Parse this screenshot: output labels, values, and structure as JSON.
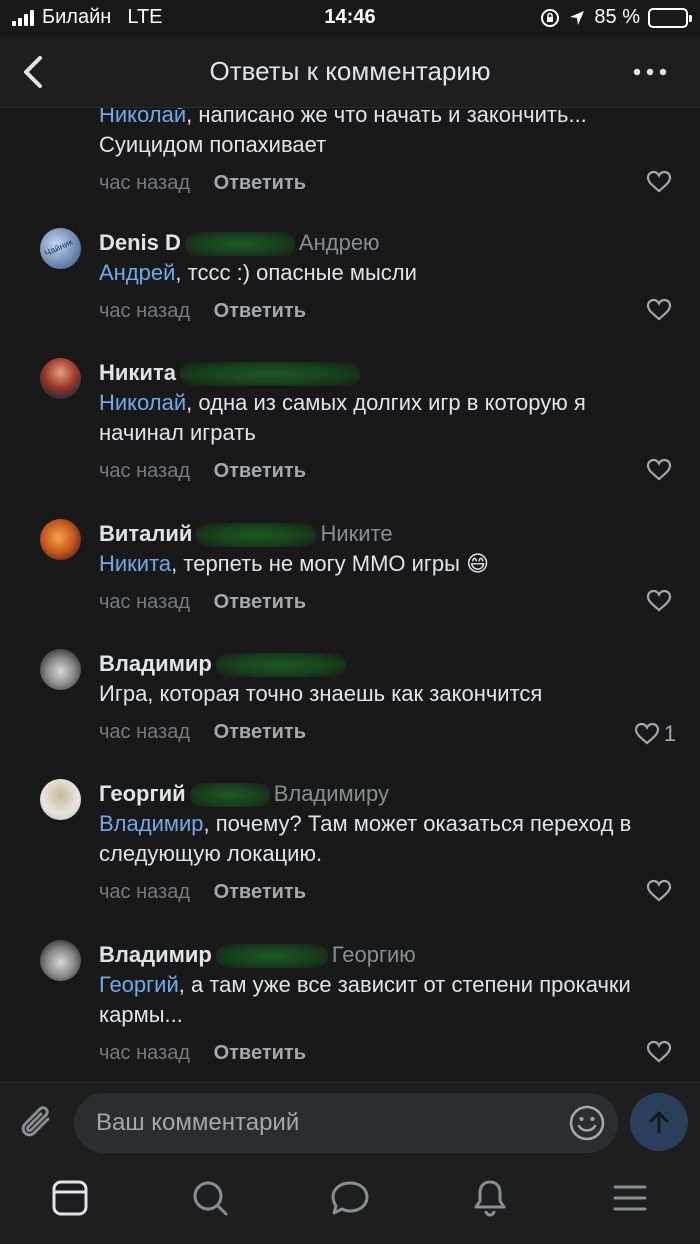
{
  "status_bar": {
    "carrier": "Билайн",
    "network": "LTE",
    "time": "14:46",
    "battery_percent": "85 %",
    "battery_level": 0.85
  },
  "header": {
    "title": "Ответы к комментарию",
    "back_icon": "chevron-left-icon",
    "more_icon": "more-horizontal-icon"
  },
  "comments": [
    {
      "name": "",
      "reply_to": "",
      "mention": "Николай",
      "text": ", написано же что начать и закончить... Суицидом попахивает",
      "time": "час назад",
      "reply_label": "Ответить",
      "likes": ""
    },
    {
      "name": "Denis D",
      "reply_to": "Андрею",
      "mention": "Андрей",
      "text": ", тссс :) опасные мысли",
      "time": "час назад",
      "reply_label": "Ответить",
      "likes": ""
    },
    {
      "name": "Никита",
      "reply_to": "",
      "mention": "Николай",
      "text": ", одна из самых долгих игр в которую я начинал играть",
      "time": "час назад",
      "reply_label": "Ответить",
      "likes": ""
    },
    {
      "name": "Виталий",
      "reply_to": "Никите",
      "mention": "Никита",
      "text": ", терпеть не могу ММО игры 😄",
      "time": "час назад",
      "reply_label": "Ответить",
      "likes": ""
    },
    {
      "name": "Владимир",
      "reply_to": "",
      "mention": "",
      "text": "Игра, которая точно знаешь как закончится",
      "time": "час назад",
      "reply_label": "Ответить",
      "likes": "1"
    },
    {
      "name": "Георгий",
      "reply_to": "Владимиру",
      "mention": "Владимир",
      "text": ", почему? Там может оказаться переход в следующую локацию.",
      "time": "час назад",
      "reply_label": "Ответить",
      "likes": ""
    },
    {
      "name": "Владимир",
      "reply_to": "Георгию",
      "mention": "Георгий",
      "text": ", а там уже все зависит от степени прокачки кармы...",
      "time": "час назад",
      "reply_label": "Ответить",
      "likes": ""
    }
  ],
  "composer": {
    "placeholder": "Ваш комментарий",
    "attach_icon": "paperclip-icon",
    "emoji_icon": "smiley-icon",
    "send_icon": "arrow-up-icon"
  },
  "tab_bar": [
    {
      "icon": "news-feed-icon"
    },
    {
      "icon": "search-icon"
    },
    {
      "icon": "messages-icon"
    },
    {
      "icon": "notifications-bell-icon"
    },
    {
      "icon": "menu-icon"
    }
  ],
  "colors": {
    "background": "#19191a",
    "accent_link": "#71aaeb",
    "secondary_text": "#77797c"
  }
}
